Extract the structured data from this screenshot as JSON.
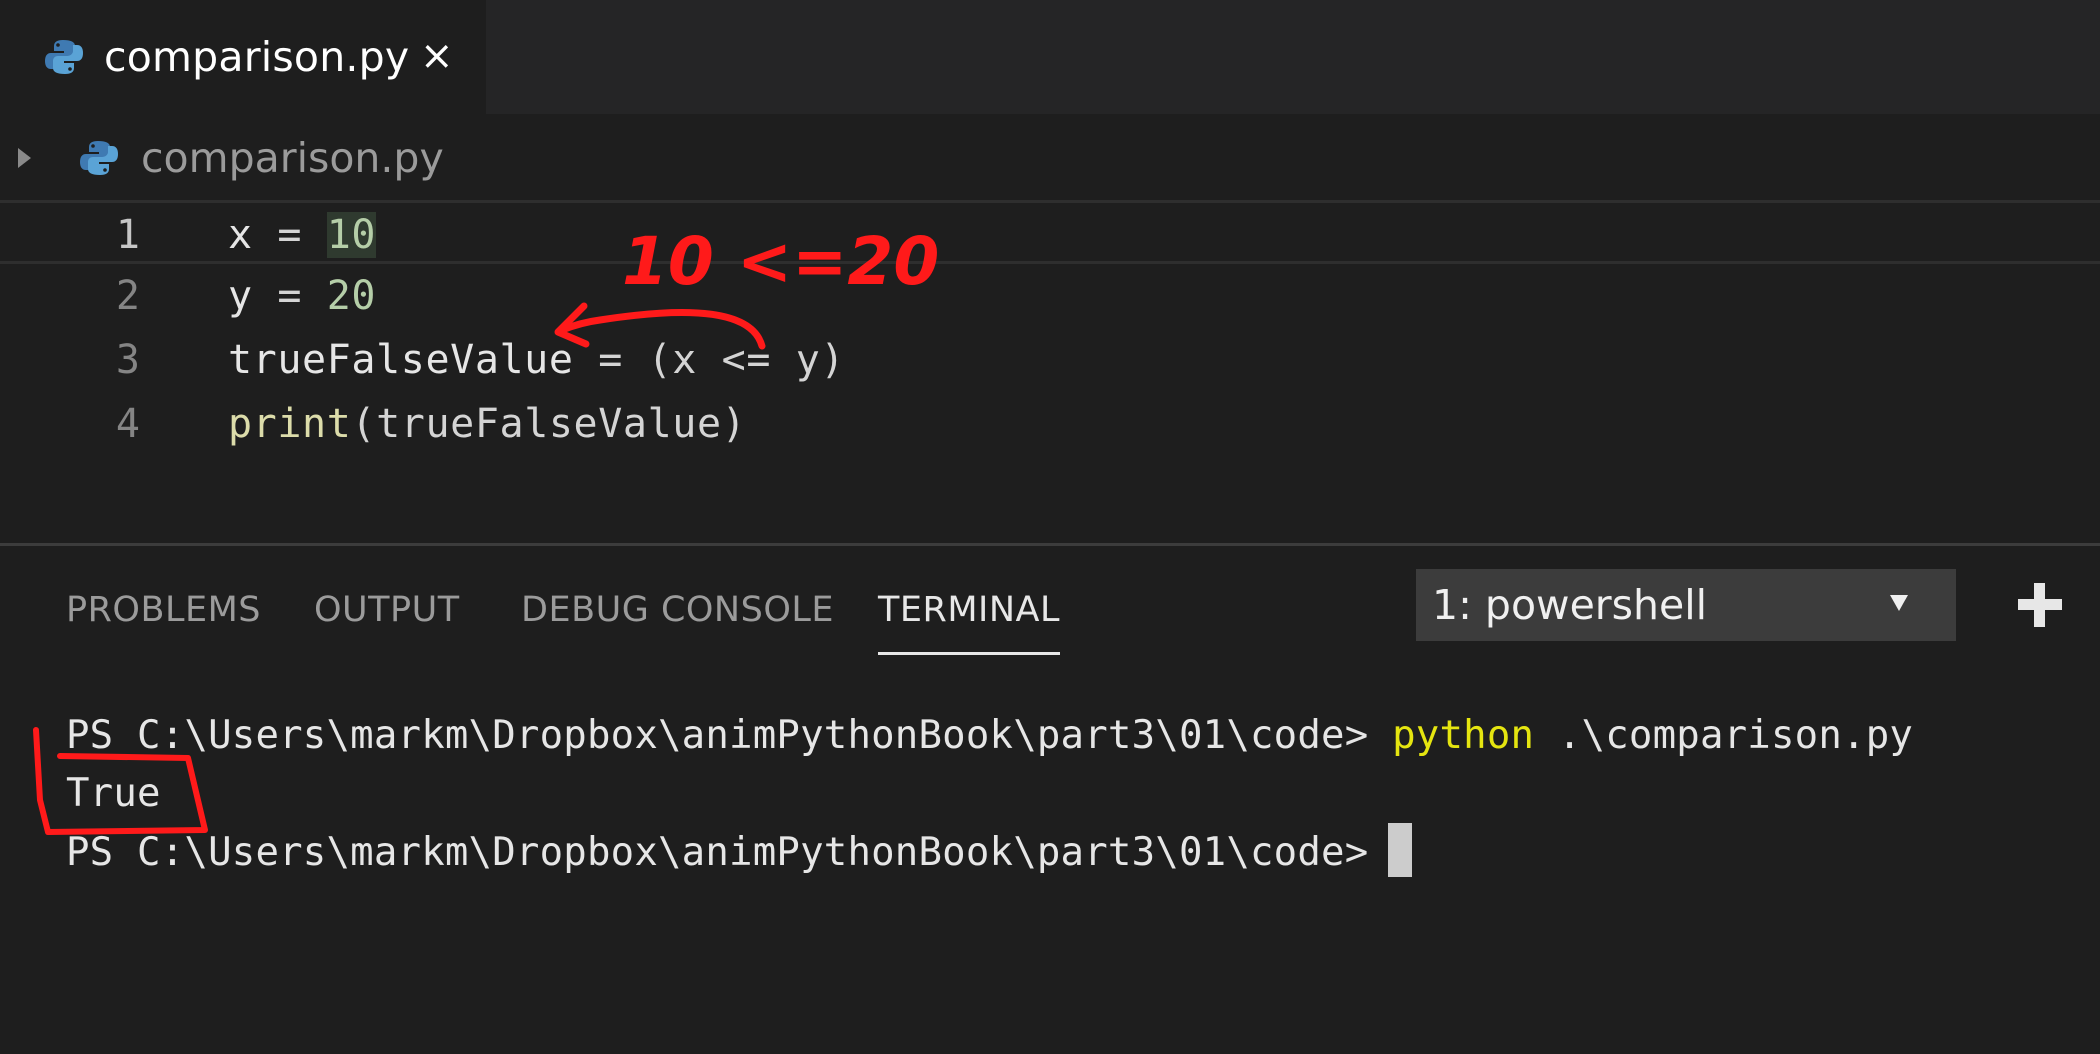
{
  "tab": {
    "filename": "comparison.py",
    "close_glyph": "×",
    "icon": "python-icon"
  },
  "breadcrumb": {
    "filename": "comparison.py",
    "icon": "python-icon"
  },
  "editor": {
    "line_numbers": [
      "1",
      "2",
      "3",
      "4"
    ],
    "lines": [
      {
        "var": "x",
        "op": " = ",
        "num": "10"
      },
      {
        "var": "y",
        "op": " = ",
        "num": "20"
      },
      {
        "var": "trueFalseValue",
        "op": " = (x <= y)"
      },
      {
        "fn": "print",
        "op": "(trueFalseValue)"
      }
    ]
  },
  "annotation": {
    "note": "10 <=20",
    "color": "#ff0000"
  },
  "panel": {
    "tabs": [
      "PROBLEMS",
      "OUTPUT",
      "DEBUG CONSOLE",
      "TERMINAL"
    ],
    "active_tab": "TERMINAL",
    "terminal_selector": "1: powershell"
  },
  "terminal": {
    "prompt": "PS C:\\Users\\markm\\Dropbox\\animPythonBook\\part3\\01\\code>",
    "command_word": "python",
    "command_arg": " .\\comparison.py",
    "output": "True"
  },
  "colors": {
    "background": "#1e1e1e",
    "number": "#b5cea8",
    "function": "#dcdcaa",
    "command": "#e5e510"
  }
}
